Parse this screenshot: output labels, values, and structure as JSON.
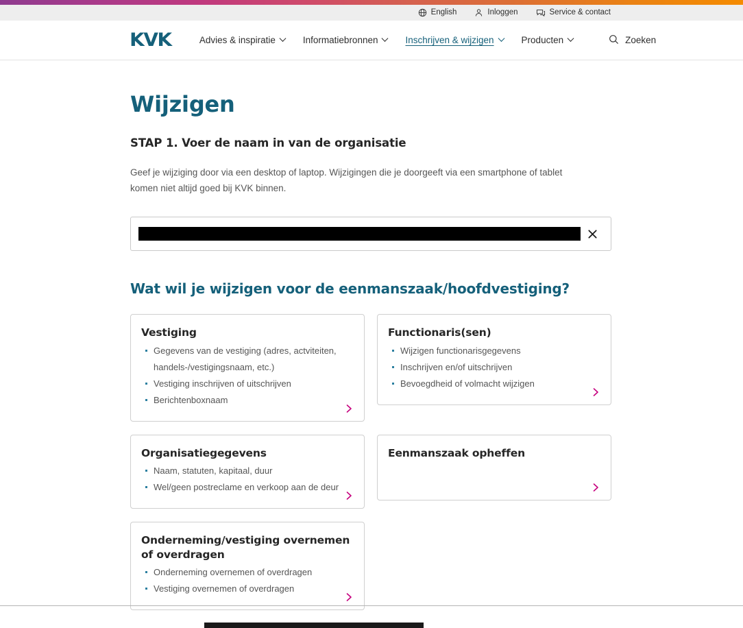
{
  "brand": {
    "logo_text": "KVK",
    "logo_color": "#15607a",
    "accent_color": "#c6007e",
    "gradient_start": "#8e3b8f",
    "gradient_end": "#f58b00"
  },
  "utility_bar": {
    "items": [
      {
        "label": "English",
        "icon": "globe-icon"
      },
      {
        "label": "Inloggen",
        "icon": "person-icon"
      },
      {
        "label": "Service & contact",
        "icon": "chat-bubble-icon"
      }
    ]
  },
  "main_nav": {
    "items": [
      {
        "label": "Advies & inspiratie",
        "has_chevron": true,
        "active": false
      },
      {
        "label": "Informatiebronnen",
        "has_chevron": true,
        "active": false
      },
      {
        "label": "Inschrijven & wijzigen",
        "has_chevron": true,
        "active": true
      },
      {
        "label": "Producten",
        "has_chevron": true,
        "active": false
      }
    ],
    "search_label": "Zoeken"
  },
  "page": {
    "title": "Wijzigen",
    "step_title": "STAP 1. Voer de naam in van de organisatie",
    "intro": "Geef je wijziging door via een desktop of laptop. Wijzigingen die je doorgeeft via een smartphone of tablet komen niet altijd goed bij KVK binnen.",
    "question": "Wat wil je wijzigen voor de eenmanszaak/hoofdvestiging?"
  },
  "search_field": {
    "value": "",
    "value_redacted": true,
    "placeholder": "",
    "clear_label": "×"
  },
  "cards": [
    {
      "title": "Vestiging",
      "items": [
        "Gegevens van de vestiging (adres, actviteiten, handels-/vestigingsnaam, etc.)",
        "Vestiging inschrijven of uitschrijven",
        "Berichtenboxnaam"
      ],
      "size": "tall"
    },
    {
      "title": "Functionaris(sen)",
      "items": [
        "Wijzigen functionarisgegevens",
        "Inschrijven en/of uitschrijven",
        "Bevoegdheid of volmacht wijzigen"
      ],
      "size": "tall"
    },
    {
      "title": "Organisatiegegevens",
      "items": [
        "Naam, statuten, kapitaal, duur",
        "Wel/geen postreclame en verkoop aan de deur"
      ],
      "size": "mid"
    },
    {
      "title": "Eenmanszaak opheffen",
      "items": [],
      "size": "mid"
    },
    {
      "title": "Onderneming/vestiging overnemen of overdragen",
      "items": [
        "Onderneming overnemen of overdragen",
        "Vestiging overnemen of overdragen"
      ],
      "size": "tall"
    }
  ]
}
